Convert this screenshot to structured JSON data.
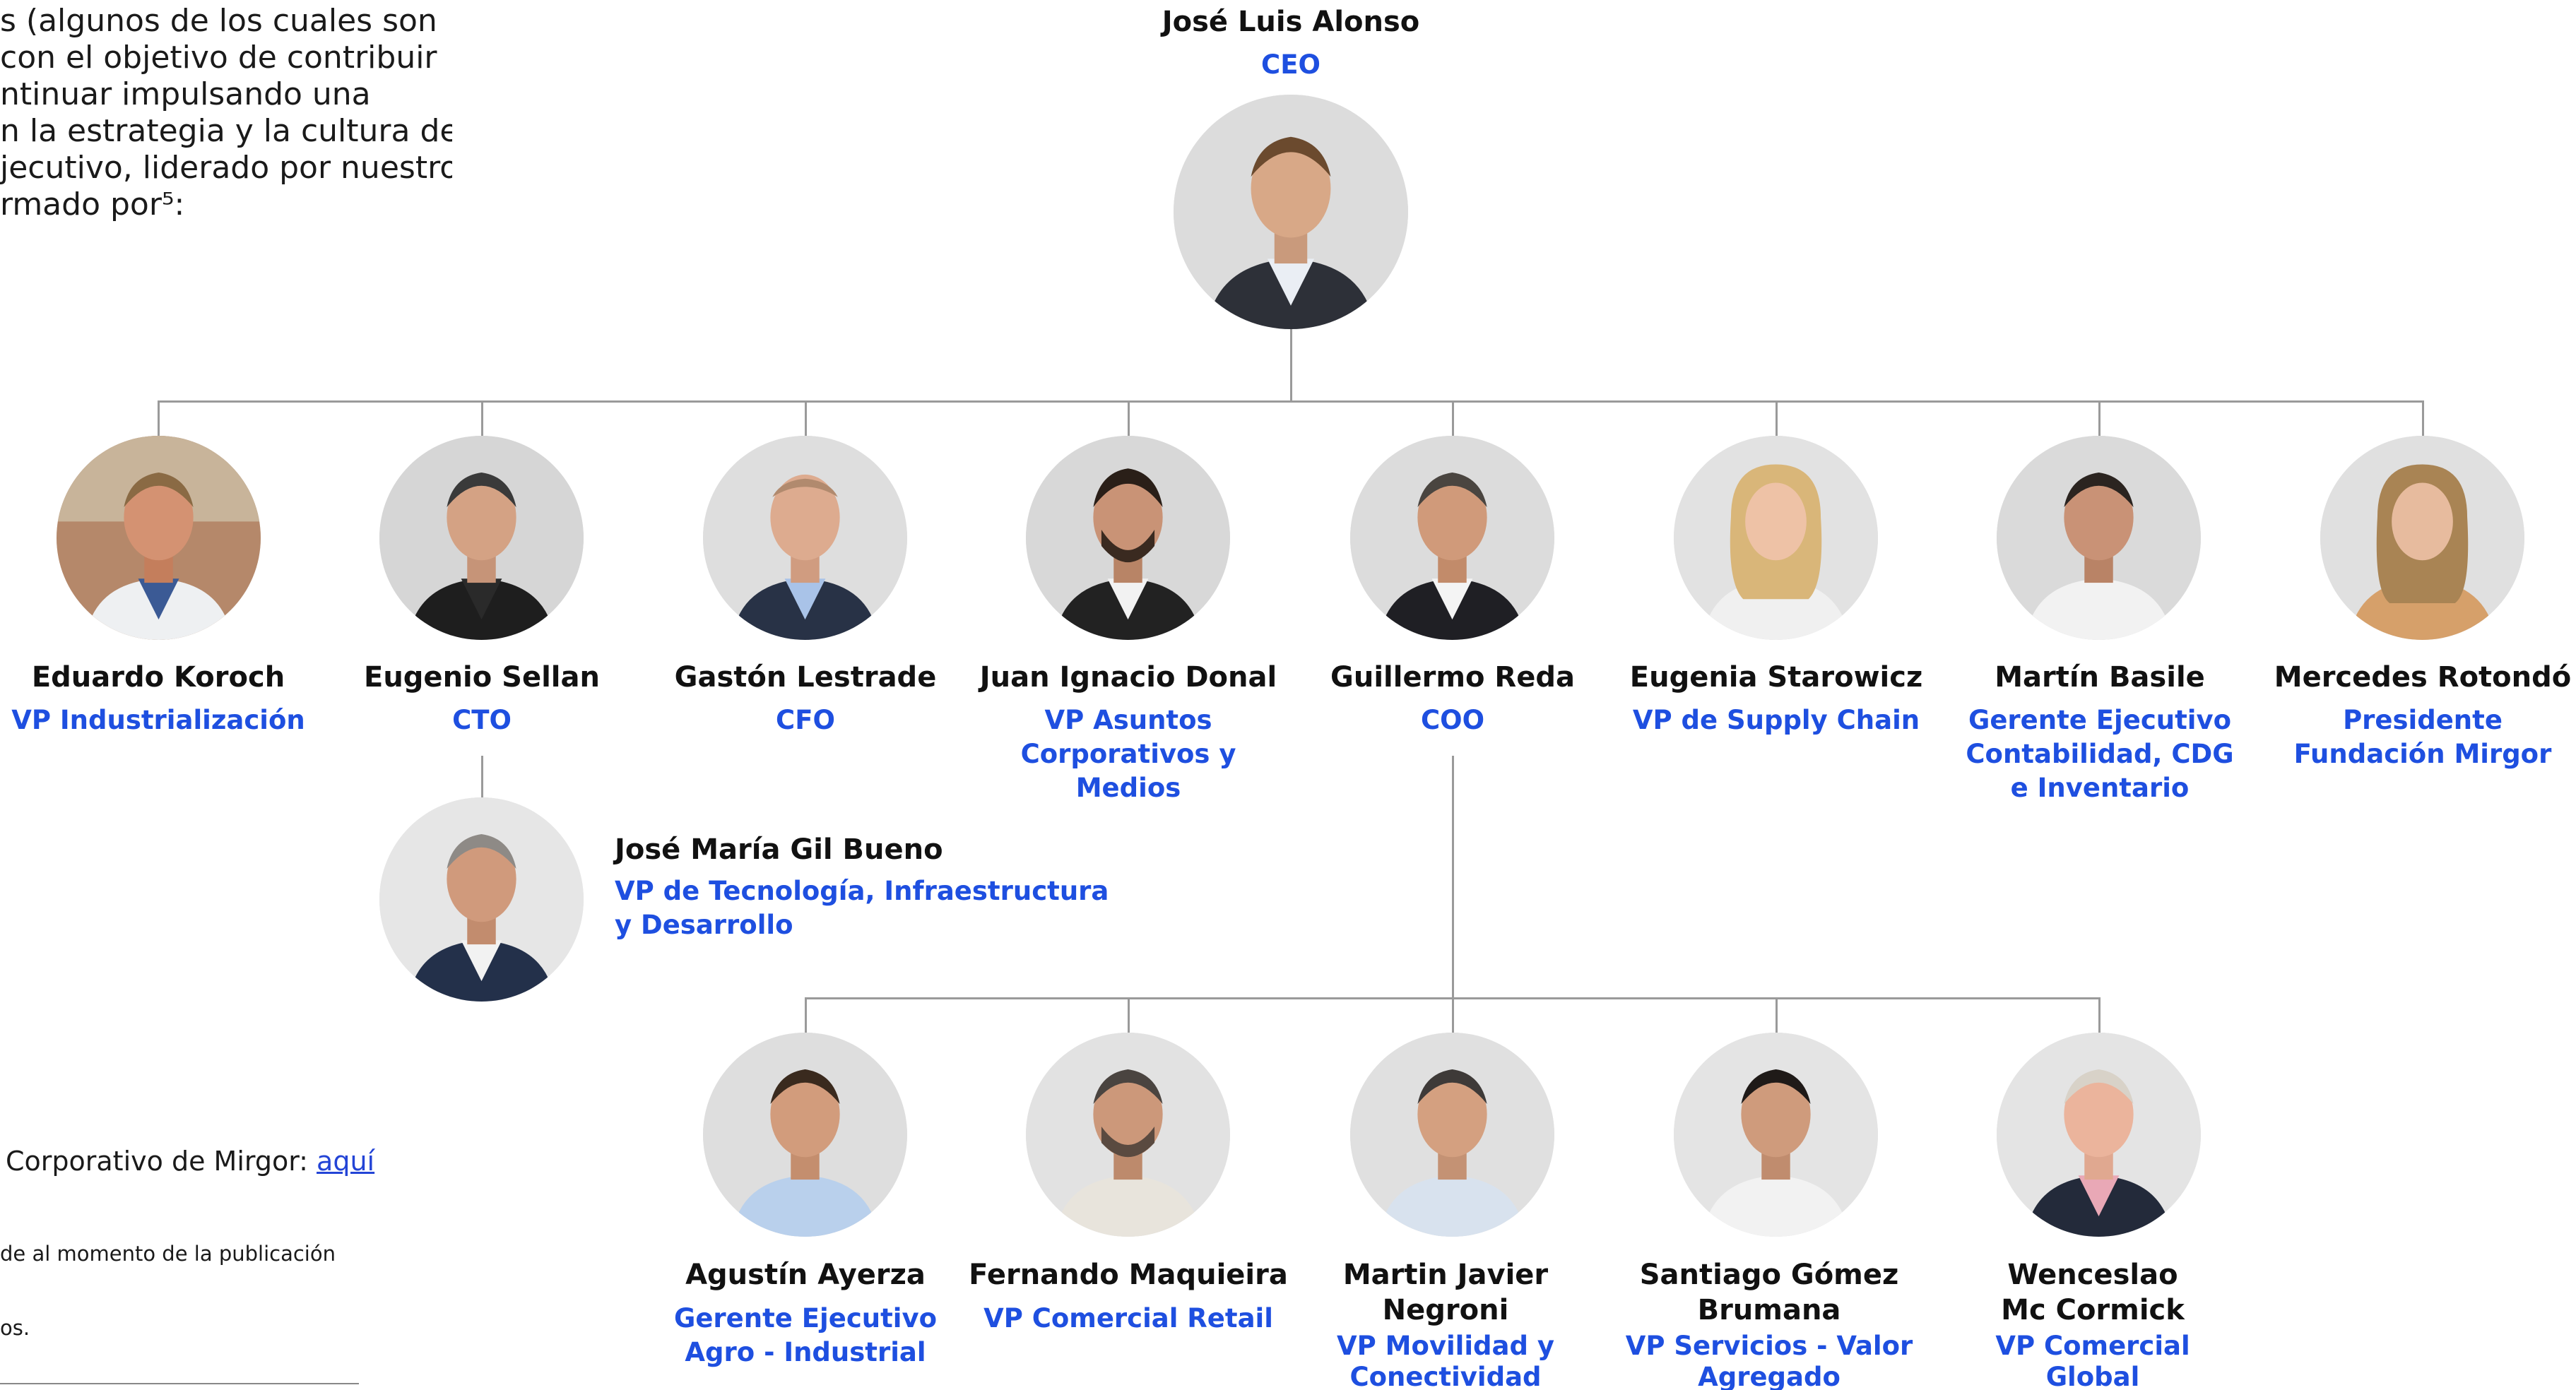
{
  "intro_lines": [
    "s (algunos de los cuales son",
    "con el objetivo de contribuir",
    "ntinuar impulsando una",
    "n la estrategia y la cultura de",
    "jecutivo, liderado por nuestro",
    "rmado por⁵:"
  ],
  "footnotes": {
    "link_prefix": "Corporativo de Mirgor: ",
    "link_text": "aquí",
    "note_1": "de al momento de la publicación",
    "note_2": "os."
  },
  "ceo": {
    "name": "José Luis Alonso",
    "role": "CEO"
  },
  "executives": [
    {
      "name": "Eduardo Koroch",
      "role": "VP Industrialización"
    },
    {
      "name": "Eugenio Sellan",
      "role": "CTO"
    },
    {
      "name": "Gastón Lestrade",
      "role": "CFO"
    },
    {
      "name": "Juan Ignacio Donal",
      "role_lines": [
        "VP Asuntos",
        "Corporativos y",
        "Medios"
      ]
    },
    {
      "name": "Guillermo Reda",
      "role": "COO"
    },
    {
      "name": "Eugenia Starowicz",
      "role": "VP de Supply Chain"
    },
    {
      "name": "Martín Basile",
      "role_lines": [
        "Gerente Ejecutivo",
        "Contabilidad, CDG",
        "e Inventario"
      ]
    },
    {
      "name": "Mercedes Rotondó",
      "role_lines": [
        "Presidente",
        "Fundación Mirgor"
      ]
    }
  ],
  "cto_report": {
    "name": "José María Gil Bueno",
    "role_lines": [
      "VP de Tecnología, Infraestructura",
      "y Desarrollo"
    ]
  },
  "coo_reports": [
    {
      "name_lines": [
        "Agustín Ayerza"
      ],
      "role_lines": [
        "Gerente Ejecutivo",
        "Agro - Industrial"
      ]
    },
    {
      "name_lines": [
        "Fernando Maquieira"
      ],
      "role_lines": [
        "VP Comercial Retail"
      ]
    },
    {
      "name_lines": [
        "Martin Javier",
        "Negroni"
      ],
      "role_lines": [
        "VP Movilidad y",
        "Conectividad"
      ]
    },
    {
      "name_lines": [
        "Santiago Gómez",
        "Brumana"
      ],
      "role_lines": [
        "VP Servicios - Valor",
        "Agregado"
      ]
    },
    {
      "name_lines": [
        "Wenceslao",
        "Mc Cormick"
      ],
      "role_lines": [
        "VP Comercial",
        "Global"
      ]
    }
  ],
  "colors": {
    "name": "#111111",
    "role": "#1e4fe0",
    "connector": "#9a9a9a"
  }
}
